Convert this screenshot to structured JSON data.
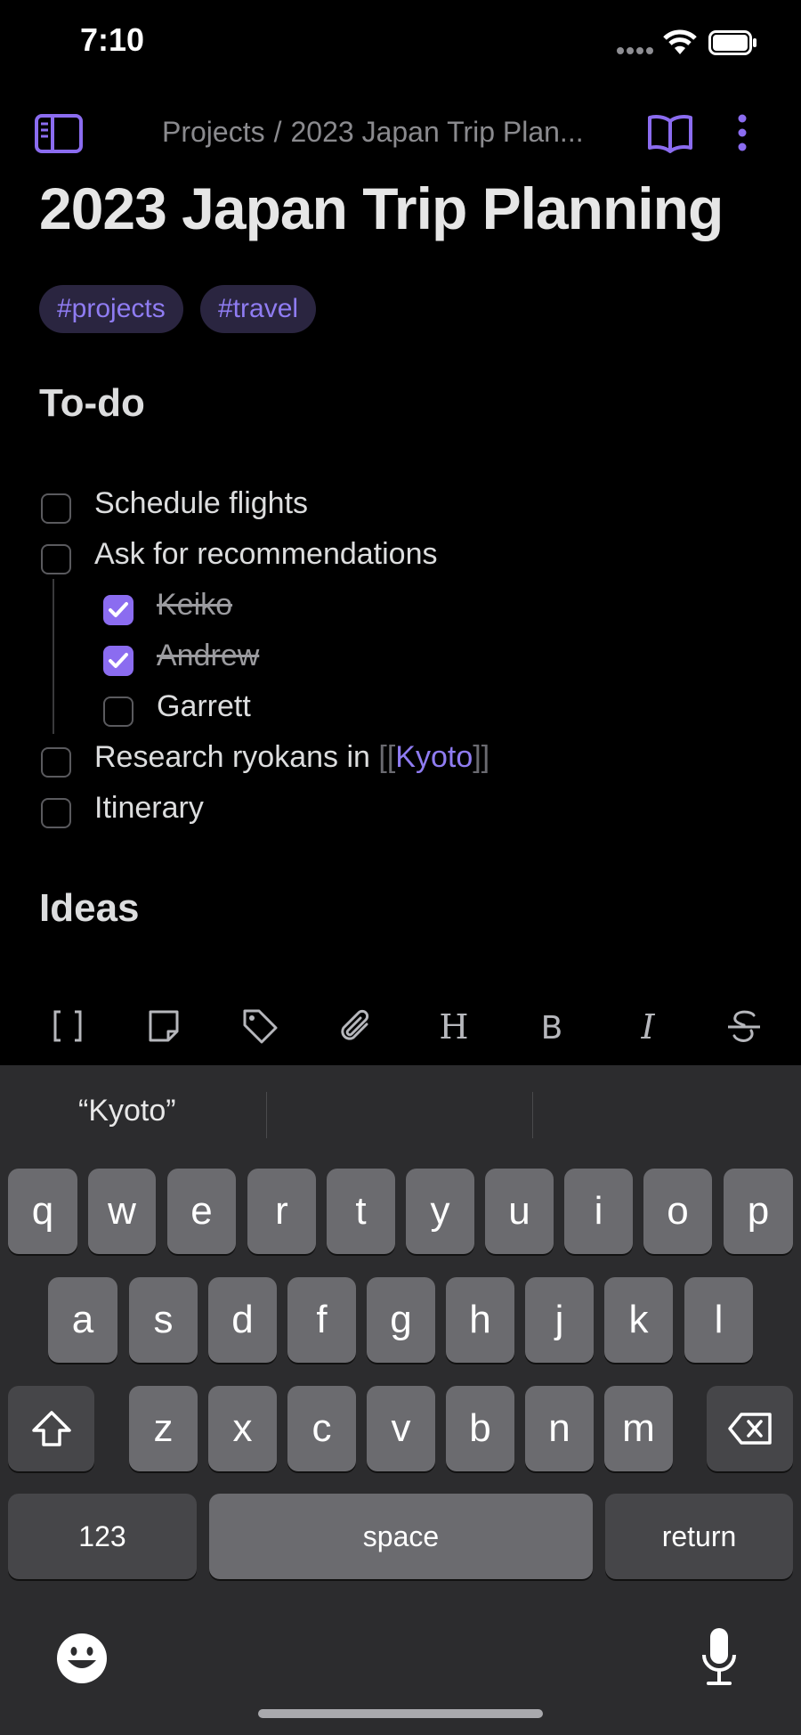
{
  "status": {
    "time": "7:10"
  },
  "nav": {
    "breadcrumb_parent": "Projects",
    "breadcrumb_separator": "/",
    "breadcrumb_current": "2023 Japan Trip Plan..."
  },
  "note": {
    "title": "2023 Japan Trip Planning",
    "tags": [
      "#projects",
      "#travel"
    ],
    "heading_todo": "To-do",
    "todos": {
      "t1": {
        "label": "Schedule flights",
        "checked": false
      },
      "t2": {
        "label": "Ask for recommendations",
        "checked": false
      },
      "t2a": {
        "label": "Keiko",
        "checked": true
      },
      "t2b": {
        "label": "Andrew",
        "checked": true
      },
      "t2c": {
        "label": "Garrett",
        "checked": false
      },
      "t3": {
        "label_prefix": "Research ryokans in",
        "link_open": "[[",
        "link_text": "Kyoto",
        "link_close": "]]",
        "checked": false
      },
      "t4": {
        "label": "Itinerary",
        "checked": false
      }
    },
    "heading_ideas": "Ideas"
  },
  "toolbar": {
    "icons": [
      "wikilink-icon",
      "file-icon",
      "tag-icon",
      "attachment-icon",
      "heading-icon",
      "bold-icon",
      "italic-icon",
      "strikethrough-icon"
    ],
    "heading_glyph": "H",
    "bold_glyph": "B",
    "italic_glyph": "I"
  },
  "keyboard": {
    "suggestions": [
      "“Kyoto”",
      "",
      ""
    ],
    "row1": [
      "q",
      "w",
      "e",
      "r",
      "t",
      "y",
      "u",
      "i",
      "o",
      "p"
    ],
    "row2": [
      "a",
      "s",
      "d",
      "f",
      "g",
      "h",
      "j",
      "k",
      "l"
    ],
    "row3": [
      "z",
      "x",
      "c",
      "v",
      "b",
      "n",
      "m"
    ],
    "numbers_label": "123",
    "space_label": "space",
    "return_label": "return"
  },
  "colors": {
    "accent": "#8b6cf0",
    "background": "#000000",
    "keyboard": "#2c2c2e"
  }
}
